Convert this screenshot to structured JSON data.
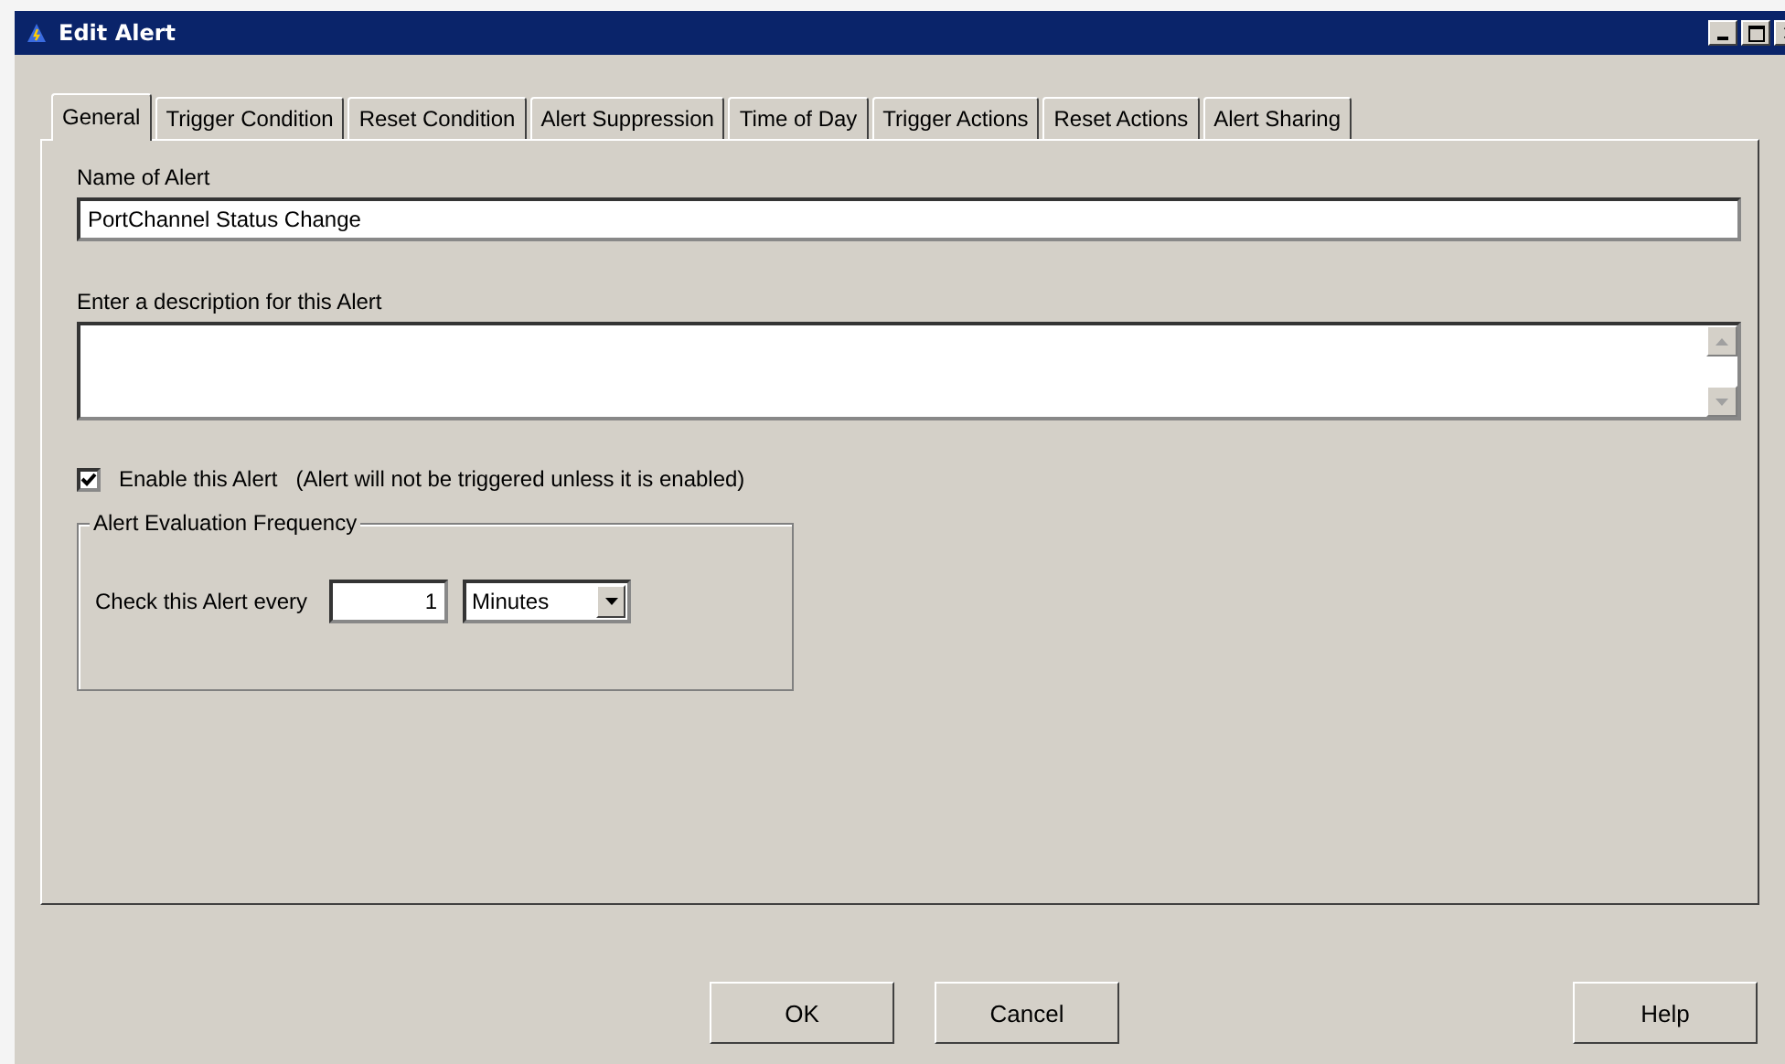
{
  "window": {
    "title": "Edit Alert"
  },
  "tabs": [
    {
      "label": "General",
      "selected": true
    },
    {
      "label": "Trigger Condition",
      "selected": false
    },
    {
      "label": "Reset Condition",
      "selected": false
    },
    {
      "label": "Alert Suppression",
      "selected": false
    },
    {
      "label": "Time of Day",
      "selected": false
    },
    {
      "label": "Trigger Actions",
      "selected": false
    },
    {
      "label": "Reset Actions",
      "selected": false
    },
    {
      "label": "Alert Sharing",
      "selected": false
    }
  ],
  "name_field": {
    "label": "Name of Alert",
    "value": "PortChannel Status Change"
  },
  "description_field": {
    "label": "Enter a description for this Alert"
  },
  "enable": {
    "label": "Enable this Alert",
    "note": "(Alert will not be triggered unless it is enabled)",
    "checked": true
  },
  "frequency": {
    "title": "Alert Evaluation Frequency",
    "label": "Check this Alert every",
    "value": "1",
    "unit": "Minutes"
  },
  "buttons": [
    {
      "label": "OK",
      "kind": "left"
    },
    {
      "label": "Cancel",
      "kind": "left"
    },
    {
      "label": "Help",
      "kind": "right"
    }
  ]
}
